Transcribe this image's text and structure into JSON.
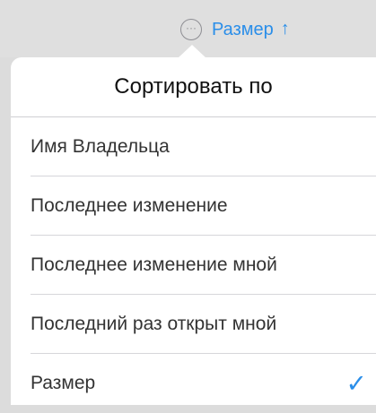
{
  "topbar": {
    "more_glyph": "···",
    "sort_label": "Размер",
    "sort_arrow": "↑"
  },
  "popover": {
    "title": "Сортировать по",
    "items": [
      {
        "label": "Имя Владельца",
        "selected": false
      },
      {
        "label": "Последнее изменение",
        "selected": false
      },
      {
        "label": "Последнее изменение мной",
        "selected": false
      },
      {
        "label": "Последний раз открыт мной",
        "selected": false
      },
      {
        "label": "Размер",
        "selected": true
      }
    ],
    "check_glyph": "✓"
  },
  "colors": {
    "accent": "#2a8ee9",
    "background": "#dfdfdf",
    "popover": "#ffffff"
  }
}
